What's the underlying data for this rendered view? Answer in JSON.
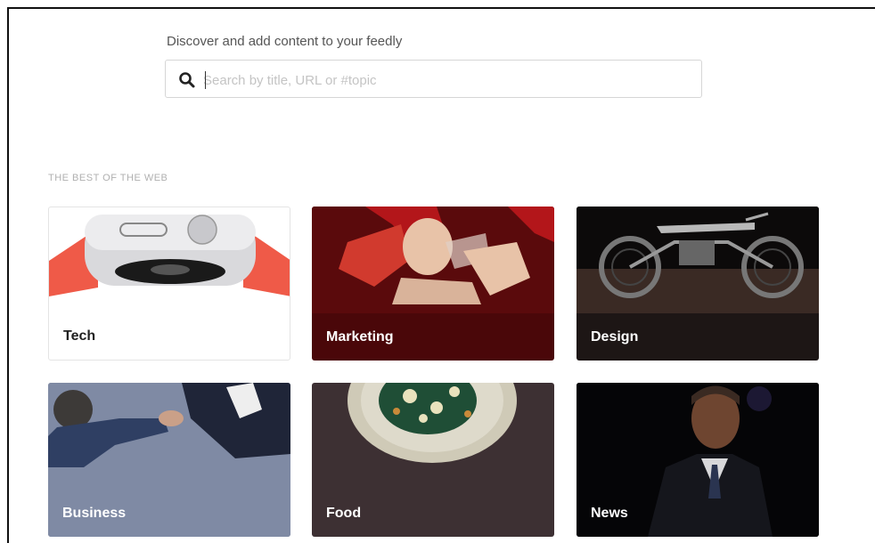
{
  "discover": {
    "prompt": "Discover and add content to your feedly",
    "search_placeholder": "Search by title, URL or #topic",
    "search_icon": "search-icon"
  },
  "section": {
    "label": "THE BEST OF THE WEB"
  },
  "topics": [
    {
      "label": "Tech",
      "image": "smartwatch"
    },
    {
      "label": "Marketing",
      "image": "woman-drinking"
    },
    {
      "label": "Design",
      "image": "motorcycle"
    },
    {
      "label": "Business",
      "image": "handshake"
    },
    {
      "label": "Food",
      "image": "salad-plate"
    },
    {
      "label": "News",
      "image": "speaker-portrait"
    }
  ]
}
